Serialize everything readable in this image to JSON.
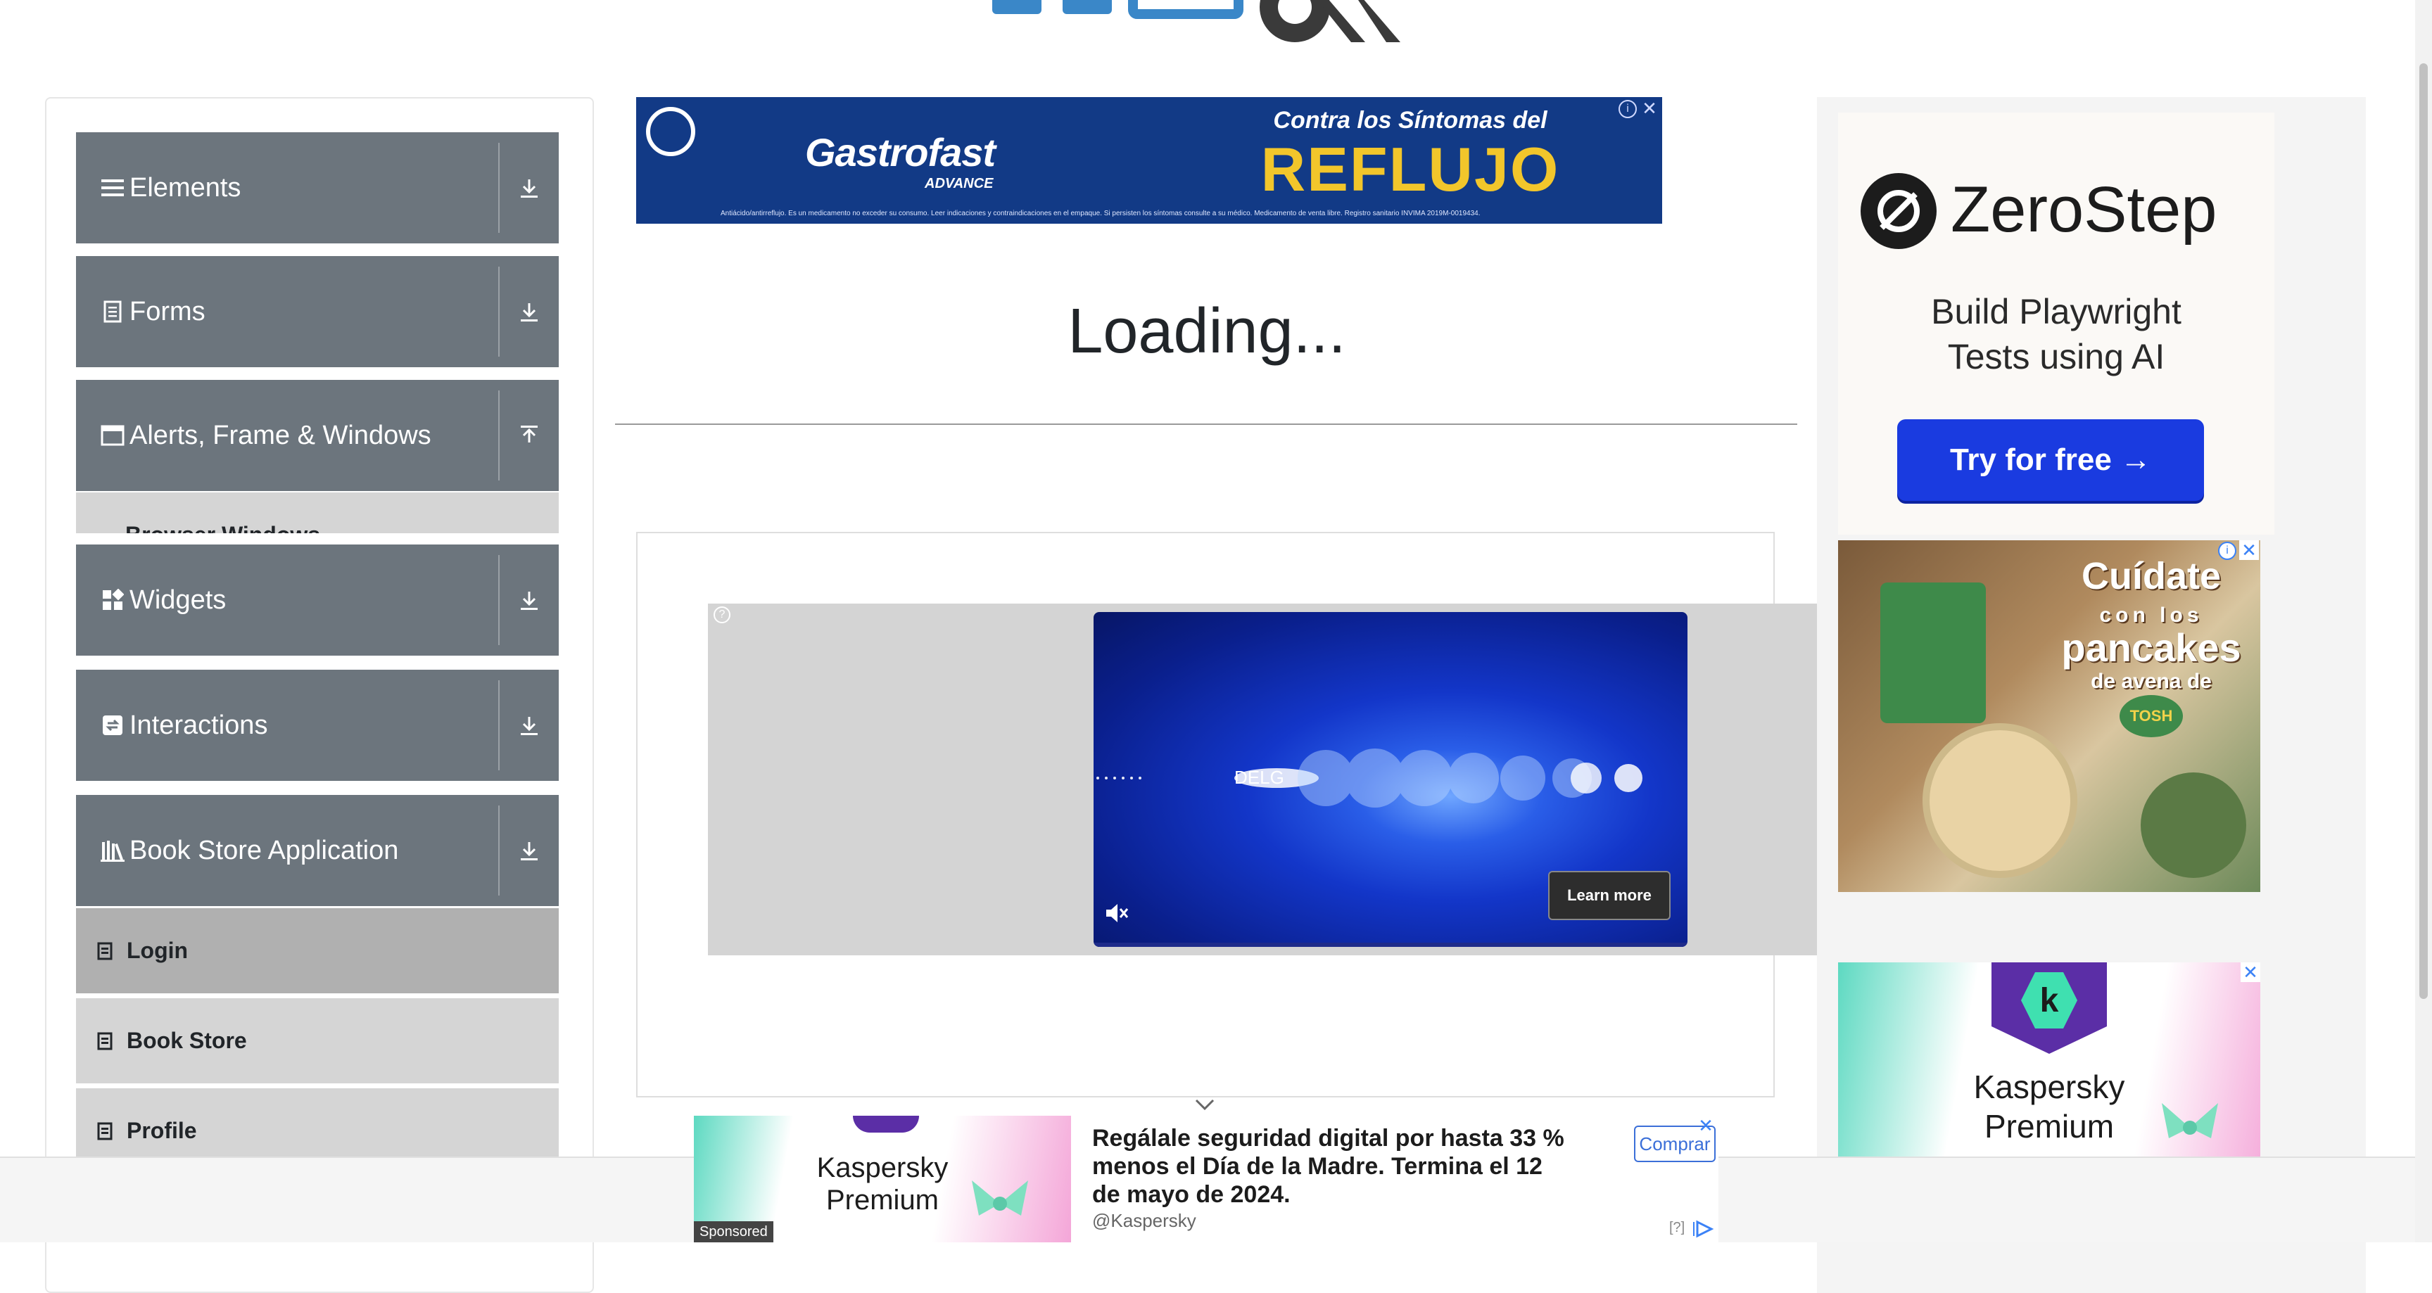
{
  "sidebar": {
    "groups": [
      {
        "label": "Elements",
        "icon": "hamburger-icon",
        "arrow": "down"
      },
      {
        "label": "Forms",
        "icon": "document-icon",
        "arrow": "down"
      },
      {
        "label": "Alerts, Frame & Windows",
        "icon": "window-icon",
        "arrow": "up"
      },
      {
        "label": "Widgets",
        "icon": "widgets-icon",
        "arrow": "down"
      },
      {
        "label": "Interactions",
        "icon": "interactions-icon",
        "arrow": "down"
      },
      {
        "label": "Book Store Application",
        "icon": "books-icon",
        "arrow": "down"
      }
    ],
    "partial_item": "Browser Windows",
    "book_items": [
      {
        "label": "Login",
        "active": true
      },
      {
        "label": "Book Store",
        "active": false
      },
      {
        "label": "Profile",
        "active": false
      }
    ]
  },
  "main": {
    "loading_text": "Loading...",
    "banner_ad": {
      "brand": "Gastrofast",
      "brand_sub": "ADVANCE",
      "headline_top": "Contra los Síntomas del",
      "headline_big": "REFLUJO",
      "fine_print": "Antiácido/antirreflujo. Es un medicamento no exceder su consumo. Leer indicaciones y contraindicaciones en el empaque. Si persisten los síntomas consulte a su médico. Medicamento de venta libre. Registro sanitario INVIMA 2019M-0019434."
    },
    "video_ad": {
      "overlay_text": "DELG",
      "learn_more": "Learn more"
    }
  },
  "right_ads": {
    "zerostep": {
      "brand": "ZeroStep",
      "tagline_line1": "Build Playwright",
      "tagline_line2": "Tests using AI",
      "cta": "Try for free →"
    },
    "tosh": {
      "line1": "Cuídate",
      "line2": "con los",
      "line3": "pancakes",
      "line4": "de avena de",
      "brand": "TOSH"
    },
    "kaspersky": {
      "logo_letter": "k",
      "name_line1": "Kaspersky",
      "name_line2": "Premium"
    }
  },
  "bottom_ad": {
    "sponsored": "Sponsored",
    "product_line1": "Kaspersky",
    "product_line2": "Premium",
    "headline": "Regálale seguridad digital por hasta 33 % menos el Día de la Madre. Termina el 12 de mayo de 2024.",
    "handle": "@Kaspersky",
    "cta": "Comprar",
    "help": "[?]"
  },
  "colors": {
    "sidebar_header": "#6c757d",
    "sub_item": "#d5d5d5",
    "sub_item_active": "#b0b0b0",
    "zerostep_cta": "#1a3be0",
    "banner_bg": "#123a86",
    "banner_yellow": "#f2c62b"
  }
}
